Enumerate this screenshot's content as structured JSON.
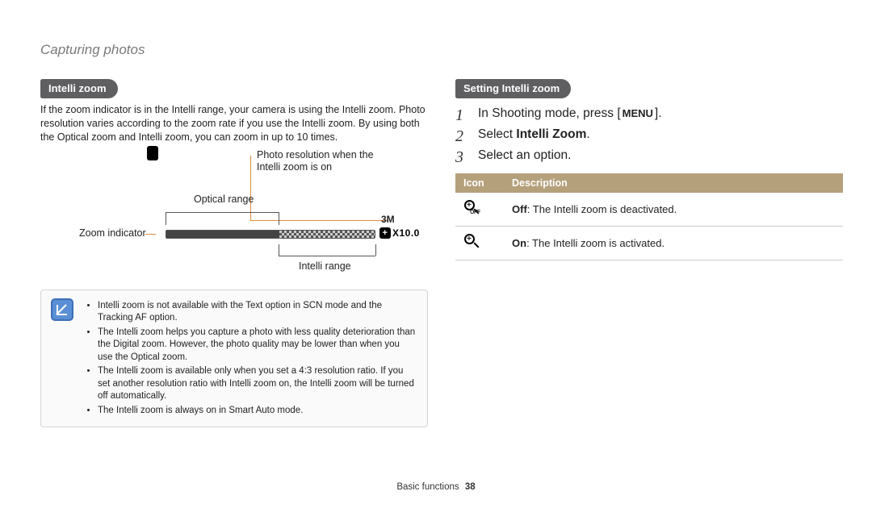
{
  "page_title": "Capturing photos",
  "left": {
    "pill": "Intelli zoom",
    "intro": "If the zoom indicator is in the Intelli range, your camera is using the Intelli zoom. Photo resolution varies according to the zoom rate if you use the Intelli zoom. By using both the Optical zoom and Intelli zoom, you can zoom in up to 10 times.",
    "diagram": {
      "photo_res_label": "Photo resolution when the Intelli zoom is on",
      "optical_range": "Optical range",
      "zoom_indicator": "Zoom indicator",
      "intelli_range": "Intelli range",
      "res_badge": "3M",
      "zoom_badge": "X10.0"
    },
    "notes": [
      "Intelli zoom is not available with the Text option in SCN mode and the Tracking AF option.",
      "The Intelli zoom helps you capture a photo with less quality deterioration than the Digital zoom. However, the photo quality may be lower than when you use the Optical zoom.",
      "The Intelli zoom is available only when you set a 4:3 resolution ratio. If you set another resolution ratio with Intelli zoom on, the Intelli zoom will be turned off automatically.",
      "The Intelli zoom is always on in Smart Auto mode."
    ]
  },
  "right": {
    "pill": "Setting Intelli zoom",
    "steps": {
      "s1_pre": "In Shooting mode, press [",
      "s1_menu": "MENU",
      "s1_post": "].",
      "s2_pre": "Select ",
      "s2_bold": "Intelli Zoom",
      "s2_post": ".",
      "s3": "Select an option."
    },
    "table": {
      "h_icon": "Icon",
      "h_desc": "Description",
      "rows": [
        {
          "bold": "Off",
          "rest": ": The Intelli zoom is deactivated."
        },
        {
          "bold": "On",
          "rest": ": The Intelli zoom is activated."
        }
      ]
    }
  },
  "footer": {
    "section": "Basic functions",
    "page": "38"
  }
}
